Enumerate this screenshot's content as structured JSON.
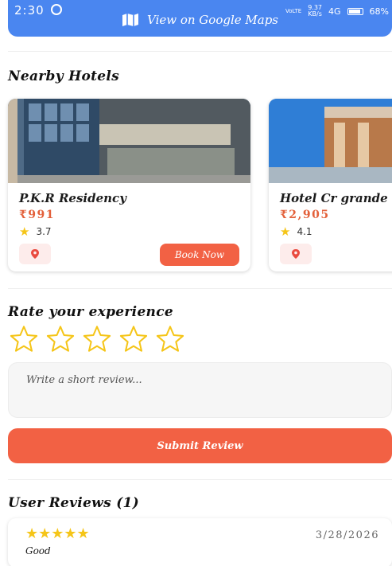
{
  "status_bar": {
    "time": "2:30",
    "network_speed_top": "9.37",
    "network_speed_bottom": "KB/s",
    "lte": "VoLTE",
    "signal": "4G",
    "battery": "68%"
  },
  "maps_button": {
    "label": "View on Google Maps",
    "icon": "map-icon"
  },
  "nearby": {
    "title": "Nearby Hotels",
    "hotels": [
      {
        "name": "P.K.R Residency",
        "price": "₹991",
        "rating": "3.7",
        "book_label": "Book Now"
      },
      {
        "name": "Hotel Cr grande",
        "price": "₹2,905",
        "rating": "4.1"
      }
    ]
  },
  "rate": {
    "title": "Rate your experience",
    "star_count": 5,
    "selected": 0,
    "review_placeholder": "Write a short review...",
    "submit_label": "Submit Review"
  },
  "user_reviews": {
    "title": "User Reviews (1)",
    "items": [
      {
        "stars": "★★★★★",
        "date": "3/28/2026",
        "text": "Good"
      }
    ]
  },
  "colors": {
    "primary_blue": "#4a86f0",
    "accent_orange": "#f26144",
    "star_yellow": "#f5c518",
    "price_color": "#e3603a"
  }
}
